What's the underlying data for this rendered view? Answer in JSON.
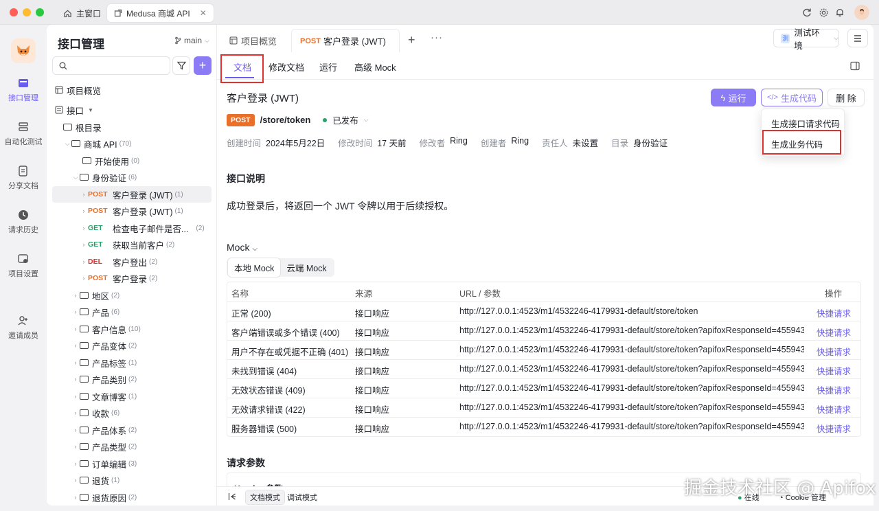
{
  "window": {
    "tabs": [
      {
        "label": "主窗口"
      },
      {
        "label": "Medusa 商城 API"
      }
    ],
    "colors": {
      "close": "#ff5f57",
      "minimize": "#febc2e",
      "zoom": "#28c840",
      "accent": "#8b7cf6",
      "post": "#e8702a",
      "get": "#26a269",
      "del": "#e0302f",
      "highlight": "#e0302f"
    }
  },
  "rail": {
    "items": [
      {
        "label": "接口管理",
        "icon": "api-icon"
      },
      {
        "label": "自动化测试",
        "icon": "test-icon"
      },
      {
        "label": "分享文档",
        "icon": "share-doc-icon"
      },
      {
        "label": "请求历史",
        "icon": "history-icon"
      },
      {
        "label": "项目设置",
        "icon": "settings-icon"
      },
      {
        "label": "邀请成员",
        "icon": "invite-icon"
      }
    ]
  },
  "sidebar": {
    "title": "接口管理",
    "branch": "main",
    "search_placeholder": "",
    "tree": [
      {
        "label": "项目概览",
        "count": ""
      },
      {
        "label": "接口",
        "count": ""
      },
      {
        "label": "根目录",
        "count": ""
      },
      {
        "label": "商城 API",
        "count": "(70)"
      },
      {
        "label": "开始使用",
        "count": "(0)"
      },
      {
        "label": "身份验证",
        "count": "(6)"
      },
      {
        "method": "POST",
        "label": "客户登录 (JWT)",
        "count": "(1)"
      },
      {
        "method": "POST",
        "label": "客户登录 (JWT)",
        "count": "(1)"
      },
      {
        "method": "GET",
        "label": "检查电子邮件是否...",
        "count": "(2)"
      },
      {
        "method": "GET",
        "label": "获取当前客户",
        "count": "(2)"
      },
      {
        "method": "DEL",
        "label": "客户登出",
        "count": "(2)"
      },
      {
        "method": "POST",
        "label": "客户登录",
        "count": "(2)"
      },
      {
        "label": "地区",
        "count": "(2)"
      },
      {
        "label": "产品",
        "count": "(6)"
      },
      {
        "label": "客户信息",
        "count": "(10)"
      },
      {
        "label": "产品变体",
        "count": "(2)"
      },
      {
        "label": "产品标签",
        "count": "(1)"
      },
      {
        "label": "产品类别",
        "count": "(2)"
      },
      {
        "label": "文章博客",
        "count": "(1)"
      },
      {
        "label": "收款",
        "count": "(6)"
      },
      {
        "label": "产品体系",
        "count": "(2)"
      },
      {
        "label": "产品类型",
        "count": "(2)"
      },
      {
        "label": "订单编辑",
        "count": "(3)"
      },
      {
        "label": "退货",
        "count": "(1)"
      },
      {
        "label": "退货原因",
        "count": "(2)"
      }
    ]
  },
  "main": {
    "tabs": [
      {
        "label": "项目概览"
      },
      {
        "method": "POST",
        "label": "客户登录 (JWT)"
      }
    ],
    "env": {
      "badge": "测",
      "label": "测试环境"
    },
    "subtabs": [
      {
        "label": "文档"
      },
      {
        "label": "修改文档"
      },
      {
        "label": "运行"
      },
      {
        "label": "高级 Mock"
      }
    ],
    "doc": {
      "title": "客户登录 (JWT)",
      "method": "POST",
      "path": "/store/token",
      "status": "已发布",
      "meta": [
        {
          "k": "创建时间",
          "v": "2024年5月22日"
        },
        {
          "k": "修改时间",
          "v": "17 天前"
        },
        {
          "k": "修改者",
          "v": "Ring"
        },
        {
          "k": "创建者",
          "v": "Ring"
        },
        {
          "k": "责任人",
          "v": "未设置"
        },
        {
          "k": "目录",
          "v": "身份验证"
        }
      ],
      "section_desc": "接口说明",
      "description": "成功登录后，将返回一个 JWT 令牌以用于后续授权。",
      "mock_heading": "Mock",
      "mock_toggle": [
        "本地 Mock",
        "云端 Mock"
      ],
      "request_params": "请求参数",
      "header_params": "Header 参数"
    },
    "buttons": {
      "run": "运行",
      "code": "生成代码",
      "delete": "删 除"
    },
    "dropdown": [
      "生成接口请求代码",
      "生成业务代码"
    ],
    "mock_table": {
      "headers": [
        "名称",
        "来源",
        "URL / 参数",
        "操作"
      ],
      "rows": [
        [
          "正常 (200)",
          "接口响应",
          "http://127.0.0.1:4523/m1/4532246-4179931-default/store/token",
          "快捷请求"
        ],
        [
          "客户端错误或多个错误 (400)",
          "接口响应",
          "http://127.0.0.1:4523/m1/4532246-4179931-default/store/token?apifoxResponseId=455943...",
          "快捷请求"
        ],
        [
          "用户不存在或凭据不正确 (401)",
          "接口响应",
          "http://127.0.0.1:4523/m1/4532246-4179931-default/store/token?apifoxResponseId=455943...",
          "快捷请求"
        ],
        [
          "未找到错误 (404)",
          "接口响应",
          "http://127.0.0.1:4523/m1/4532246-4179931-default/store/token?apifoxResponseId=455943...",
          "快捷请求"
        ],
        [
          "无效状态错误 (409)",
          "接口响应",
          "http://127.0.0.1:4523/m1/4532246-4179931-default/store/token?apifoxResponseId=455943...",
          "快捷请求"
        ],
        [
          "无效请求错误 (422)",
          "接口响应",
          "http://127.0.0.1:4523/m1/4532246-4179931-default/store/token?apifoxResponseId=455943...",
          "快捷请求"
        ],
        [
          "服务器错误 (500)",
          "接口响应",
          "http://127.0.0.1:4523/m1/4532246-4179931-default/store/token?apifoxResponseId=455943...",
          "快捷请求"
        ]
      ]
    }
  },
  "footer": {
    "doc_mode": "文档模式",
    "debug_mode": "调试模式",
    "online": "在线",
    "cookie": "Cookie 管理"
  },
  "watermark": "掘金技术社区 @ Apifox"
}
